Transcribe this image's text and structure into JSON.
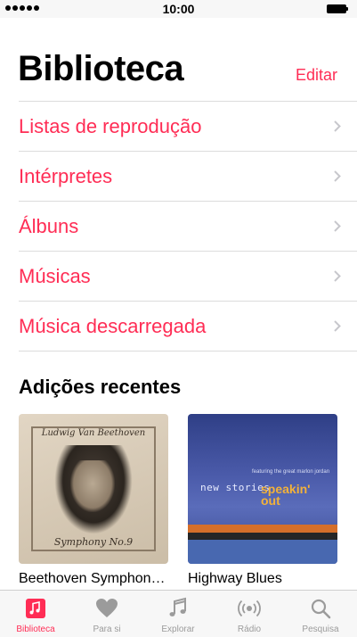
{
  "status_bar": {
    "time": "10:00"
  },
  "header": {
    "title": "Biblioteca",
    "edit_label": "Editar"
  },
  "menu": {
    "items": [
      {
        "label": "Listas de reprodução"
      },
      {
        "label": "Intérpretes"
      },
      {
        "label": "Álbuns"
      },
      {
        "label": "Músicas"
      },
      {
        "label": "Música descarregada"
      }
    ]
  },
  "recent": {
    "title": "Adições recentes",
    "albums": [
      {
        "title": "Beethoven Symphon…",
        "cover_top": "Ludwig Van Beethoven",
        "cover_bottom": "Symphony No.9"
      },
      {
        "title": "Highway Blues",
        "cover_text_1": "new stories",
        "cover_text_2": "speakin' out",
        "cover_text_3": "featuring the great marlon jordan"
      }
    ]
  },
  "tabbar": {
    "tabs": [
      {
        "label": "Biblioteca",
        "icon": "music-note-icon",
        "active": true
      },
      {
        "label": "Para si",
        "icon": "heart-icon",
        "active": false
      },
      {
        "label": "Explorar",
        "icon": "music-notes-icon",
        "active": false
      },
      {
        "label": "Rádio",
        "icon": "radio-icon",
        "active": false
      },
      {
        "label": "Pesquisa",
        "icon": "search-icon",
        "active": false
      }
    ]
  },
  "colors": {
    "accent": "#ff2d55",
    "tab_inactive": "#9b9b9b"
  }
}
